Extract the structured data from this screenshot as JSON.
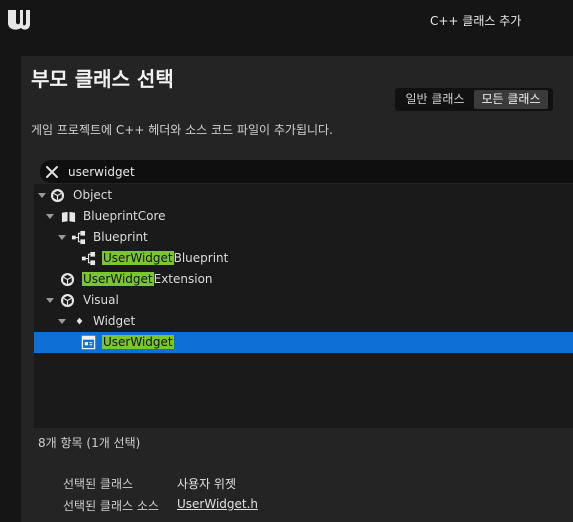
{
  "window": {
    "title": "C++ 클래스 추가"
  },
  "dialog": {
    "heading": "부모 클래스 선택",
    "description": "게임 프로젝트에 C++ 헤더와 소스 코드 파일이 추가됩니다.",
    "toggle": {
      "common_label": "일반 클래스",
      "all_label": "모든 클래스",
      "active": "all"
    }
  },
  "search": {
    "value": "userwidget"
  },
  "tree": [
    {
      "prefix": "",
      "match": "",
      "suffix": "Object",
      "expanded": true,
      "icon": "object-icon"
    },
    {
      "prefix": "",
      "match": "",
      "suffix": "BlueprintCore",
      "expanded": true,
      "icon": "book-icon"
    },
    {
      "prefix": "",
      "match": "",
      "suffix": "Blueprint",
      "expanded": true,
      "icon": "blueprint-icon"
    },
    {
      "prefix": "",
      "match": "UserWidget",
      "suffix": "Blueprint",
      "expanded": false,
      "icon": "blueprint-icon"
    },
    {
      "prefix": "",
      "match": "UserWidget",
      "suffix": "Extension",
      "expanded": false,
      "icon": "object-icon"
    },
    {
      "prefix": "",
      "match": "",
      "suffix": "Visual",
      "expanded": true,
      "icon": "object-icon"
    },
    {
      "prefix": "",
      "match": "",
      "suffix": "Widget",
      "expanded": true,
      "icon": "diamond-icon"
    },
    {
      "prefix": "",
      "match": "UserWidget",
      "suffix": "",
      "expanded": false,
      "icon": "user-widget-icon",
      "selected": true
    }
  ],
  "footer": {
    "count": "8개 항목 (1개 선택)",
    "selected_class_label": "선택된 클래스",
    "selected_class_value": "사용자 위젯",
    "selected_source_label": "선택된 클래스 소스",
    "selected_source_value": "UserWidget.h"
  },
  "colors": {
    "highlight": "#7bc62d",
    "selection": "#0e6fd6",
    "panel": "#242424"
  }
}
